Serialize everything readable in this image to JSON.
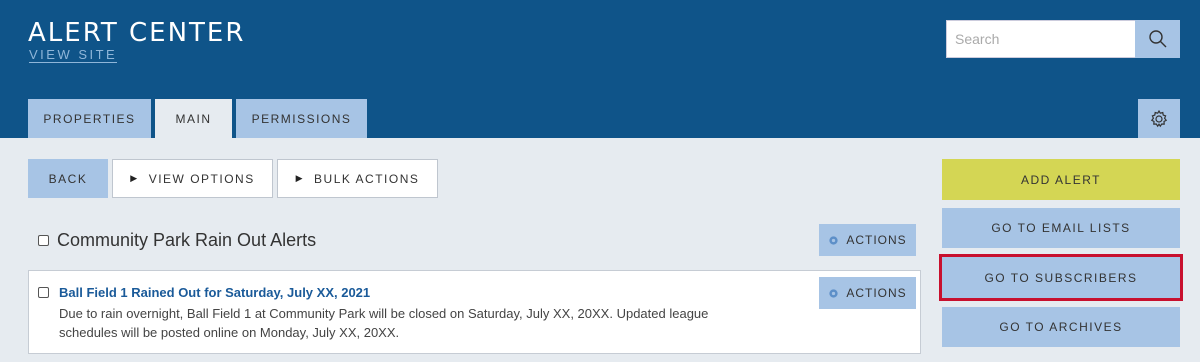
{
  "header": {
    "title": "ALERT CENTER",
    "view_site": "VIEW SITE",
    "search_placeholder": "Search"
  },
  "tabs": [
    {
      "label": "PROPERTIES",
      "active": false
    },
    {
      "label": "MAIN",
      "active": true
    },
    {
      "label": "PERMISSIONS",
      "active": false
    }
  ],
  "toolbar": {
    "back": "BACK",
    "view_options": "VIEW OPTIONS",
    "bulk_actions": "BULK ACTIONS"
  },
  "group": {
    "title": "Community Park Rain Out Alerts",
    "actions": "ACTIONS"
  },
  "items": [
    {
      "title": "Ball Field 1 Rained Out for Saturday, July XX, 2021",
      "description": "Due to rain overnight, Ball Field 1 at Community Park will be closed on Saturday, July XX, 20XX. Updated league schedules will be posted online on Monday, July XX, 20XX.",
      "actions": "ACTIONS"
    }
  ],
  "sidebar": {
    "add_alert": "ADD ALERT",
    "go_to_email_lists": "GO TO EMAIL LISTS",
    "go_to_subscribers": "GO TO SUBSCRIBERS",
    "go_to_archives": "GO TO ARCHIVES"
  },
  "colors": {
    "header_bg": "#0f5489",
    "button_blue": "#a7c4e5",
    "add_alert": "#d4d654",
    "highlight": "#c8102e"
  },
  "icons": [
    "search-icon",
    "gear-icon",
    "triangle-right-icon",
    "actions-gear-icon"
  ]
}
